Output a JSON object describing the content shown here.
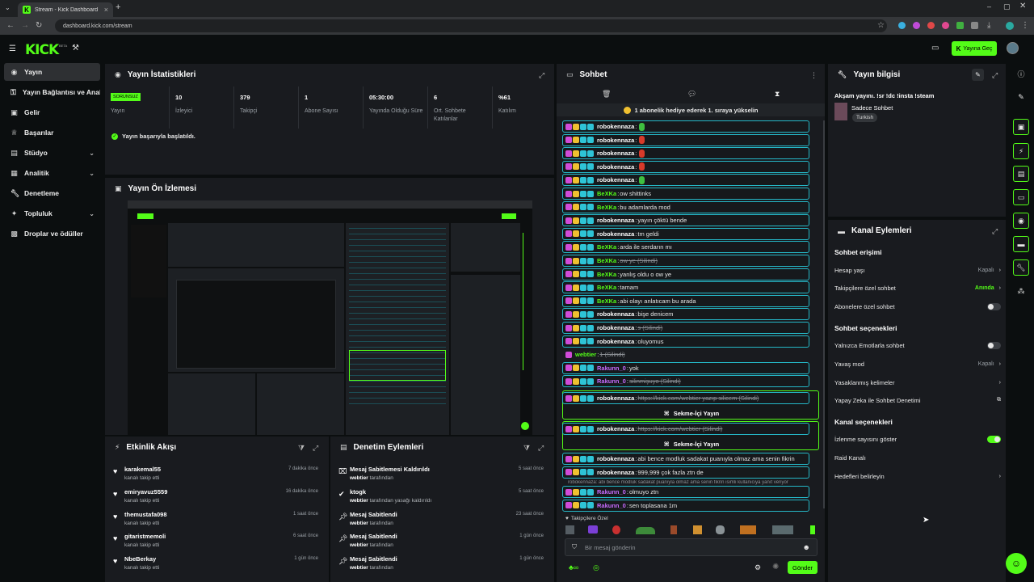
{
  "browser": {
    "tab_title": "Stream - Kick Dashboard",
    "url": "dashboard.kick.com/stream"
  },
  "header": {
    "logo": "KICK",
    "logo_beta": "BETA",
    "go_live": "Yayına Geç"
  },
  "sidebar": {
    "items": [
      {
        "label": "Yayın",
        "icon": "circle-dot-icon",
        "active": true
      },
      {
        "label": "Yayın Bağlantısı ve Anahtarı",
        "icon": "key-icon"
      },
      {
        "label": "Gelir",
        "icon": "money-icon"
      },
      {
        "label": "Başarılar",
        "icon": "trophy-icon"
      },
      {
        "label": "Stüdyo",
        "icon": "studio-icon",
        "chevron": true
      },
      {
        "label": "Analitik",
        "icon": "analytics-icon",
        "chevron": true
      },
      {
        "label": "Denetleme",
        "icon": "wrench-icon"
      },
      {
        "label": "Topluluk",
        "icon": "community-icon",
        "chevron": true
      },
      {
        "label": "Droplar ve ödüller",
        "icon": "gift-icon"
      }
    ]
  },
  "stats_panel": {
    "title": "Yayın İstatistikleri",
    "badge": "SORUNSUZ",
    "stats": [
      {
        "value": "",
        "label": "Yayın"
      },
      {
        "value": "10",
        "label": "İzleyici"
      },
      {
        "value": "379",
        "label": "Takipçi"
      },
      {
        "value": "1",
        "label": "Abone Sayısı"
      },
      {
        "value": "05:30:00",
        "label": "Yayında Olduğu Süre"
      },
      {
        "value": "6",
        "label": "Ort. Sohbete Katılanlar"
      },
      {
        "value": "%61",
        "label": "Katılım"
      }
    ],
    "success_message": "Yayın başarıyla başlatıldı."
  },
  "preview_panel": {
    "title": "Yayın Ön İzlemesi"
  },
  "activity_panel": {
    "title": "Etkinlik Akışı",
    "items": [
      {
        "name": "karakemal55",
        "sub": "kanalı takip etti",
        "time": "7 dakika önce"
      },
      {
        "name": "emiryavuz5559",
        "sub": "kanalı takip etti",
        "time": "16 dakika önce"
      },
      {
        "name": "themustafa098",
        "sub": "kanalı takip etti",
        "time": "1 saat önce"
      },
      {
        "name": "gitaristmemoli",
        "sub": "kanalı takip etti",
        "time": "6 saat önce"
      },
      {
        "name": "NbeBerkay",
        "sub": "kanalı takip etti",
        "time": "1 gün önce"
      }
    ]
  },
  "moderation_panel": {
    "title": "Denetim Eylemleri",
    "items": [
      {
        "name": "Mesaj Sabitlemesi Kaldırıldı",
        "actor": "webtier",
        "sub": "tarafından",
        "time": "5 saat önce",
        "icon": "unpin-icon"
      },
      {
        "name": "ktogk",
        "actor": "webtier",
        "sub": "tarafından yasağı kaldırıldı",
        "time": "5 saat önce",
        "icon": "check-circle-icon"
      },
      {
        "name": "Mesaj Sabitlendi",
        "actor": "webtier",
        "sub": "tarafından",
        "time": "23 saat önce",
        "icon": "pin-icon"
      },
      {
        "name": "Mesaj Sabitlendi",
        "actor": "webtier",
        "sub": "tarafından",
        "time": "1 gün önce",
        "icon": "pin-icon"
      },
      {
        "name": "Mesaj Sabitlendi",
        "actor": "webtier",
        "sub": "tarafından",
        "time": "1 gün önce",
        "icon": "pin-icon"
      }
    ]
  },
  "chat_panel": {
    "title": "Sohbet",
    "gift_banner": "1 abonelik hediye ederek 1. sıraya yükselin",
    "messages": [
      {
        "user": "robokennaza",
        "text": "",
        "emote": "green",
        "color": "#ffffff",
        "deleted": false
      },
      {
        "user": "robokennaza",
        "text": "",
        "emote": "red",
        "color": "#ffffff",
        "deleted": false
      },
      {
        "user": "robokennaza",
        "text": "",
        "emote": "red",
        "color": "#ffffff",
        "deleted": false
      },
      {
        "user": "robokennaza",
        "text": "",
        "emote": "red",
        "color": "#ffffff",
        "deleted": false
      },
      {
        "user": "robokennaza",
        "text": "",
        "emote": "green",
        "color": "#ffffff",
        "deleted": false
      },
      {
        "user": "BeXKa",
        "text": "ow shittinks",
        "color": "#53fc18",
        "deleted": false
      },
      {
        "user": "BeXKa",
        "text": "bu adamlarda mod",
        "color": "#53fc18",
        "deleted": false
      },
      {
        "user": "robokennaza",
        "text": "yayın çöktü bende",
        "color": "#ffffff",
        "deleted": false
      },
      {
        "user": "robokennaza",
        "text": "tm geldi",
        "color": "#ffffff",
        "deleted": false
      },
      {
        "user": "BeXKa",
        "text": "arda ile serdarın mı",
        "color": "#53fc18",
        "deleted": false
      },
      {
        "user": "BeXKa",
        "text": "ow ye (Silindi)",
        "color": "#53fc18",
        "deleted": true
      },
      {
        "user": "BeXKa",
        "text": "yanlış oldu o ow ye",
        "color": "#53fc18",
        "deleted": false
      },
      {
        "user": "BeXKa",
        "text": "tamam",
        "color": "#53fc18",
        "deleted": false
      },
      {
        "user": "BeXKa",
        "text": "abi olayı anlatıcam bu arada",
        "color": "#53fc18",
        "deleted": false
      },
      {
        "user": "robokennaza",
        "text": "bişe denicem",
        "color": "#ffffff",
        "deleted": false
      },
      {
        "user": "robokennaza",
        "text": "s (Silindi)",
        "color": "#ffffff",
        "deleted": true
      },
      {
        "user": "robokennaza",
        "text": "oluyomus",
        "color": "#ffffff",
        "deleted": false
      },
      {
        "user": "webtier",
        "text": "1 (Silindi)",
        "color": "#53fc18",
        "deleted": true,
        "plain": true
      },
      {
        "user": "Rakunn_0",
        "text": "yok",
        "color": "#c86bff",
        "deleted": false
      },
      {
        "user": "Rakunn_0",
        "text": "silinmişuyo (Silindi)",
        "color": "#c86bff",
        "deleted": true
      }
    ],
    "highlighted": [
      {
        "user": "robokennaza",
        "text": "https://kick.com/webtier yazıp silicem (Silindi)",
        "button": "Sekme-İçi Yayın"
      },
      {
        "user": "robokennaza",
        "text": "https://kick.com/webtier (Silindi)",
        "button": "Sekme-İçi Yayın"
      }
    ],
    "after": [
      {
        "user": "robokennaza",
        "text": "abi bence modluk sadakat puanıyla olmaz ama senin fikrin",
        "color": "#ffffff"
      },
      {
        "user": "robokennaza",
        "text": "999,999 çok fazla ztn de",
        "color": "#ffffff"
      }
    ],
    "reply_quote": "robokennaza: abi bence modluk sadakat puanıyla olmaz ama senin fikrin isimli kullanıcıya yanıt veriyor",
    "after2": [
      {
        "user": "Rakunn_0",
        "text": "olmuyo ztn",
        "color": "#c86bff"
      },
      {
        "user": "Rakunn_0",
        "text": "sen toplasana 1m",
        "color": "#c86bff"
      }
    ],
    "followers_only": "Takipçilere Özel",
    "input_placeholder": "Bir mesaj gönderin",
    "send": "Gönder"
  },
  "info_panel": {
    "title": "Yayın bilgisi",
    "stream_title": "Akşam yayını. !sr !dc !insta !steam",
    "category": "Sadece Sohbet",
    "tag": "Turkish"
  },
  "actions_panel": {
    "title": "Kanal Eylemleri",
    "sections": [
      {
        "title": "Sohbet erişimi",
        "rows": [
          {
            "label": "Hesap yaşı",
            "value": "Kapalı",
            "kind": "chevron"
          },
          {
            "label": "Takipçilere özel sohbet",
            "value": "Anında",
            "kind": "chevron",
            "accent": true
          },
          {
            "label": "Abonelere özel sohbet",
            "kind": "toggle",
            "on": false
          }
        ]
      },
      {
        "title": "Sohbet seçenekleri",
        "rows": [
          {
            "label": "Yalnızca Emotlarla sohbet",
            "kind": "toggle",
            "on": false
          },
          {
            "label": "Yavaş mod",
            "value": "Kapalı",
            "kind": "chevron"
          },
          {
            "label": "Yasaklanmış kelimeler",
            "value": "",
            "kind": "chevron"
          },
          {
            "label": "Yapay Zeka ile Sohbet Denetimi",
            "value": "",
            "kind": "external"
          }
        ]
      },
      {
        "title": "Kanal seçenekleri",
        "rows": [
          {
            "label": "İzlenme sayısını göster",
            "kind": "toggle",
            "on": true
          },
          {
            "label": "Raid Kanalı",
            "value": "",
            "kind": "none"
          },
          {
            "label": "Hedefleri belirleyin",
            "value": "",
            "kind": "chevron"
          }
        ]
      }
    ]
  },
  "colors": {
    "accent": "#53fc18",
    "panel": "#191b1f",
    "background": "#0b0e0f",
    "chat_border": "#25b8c7"
  }
}
